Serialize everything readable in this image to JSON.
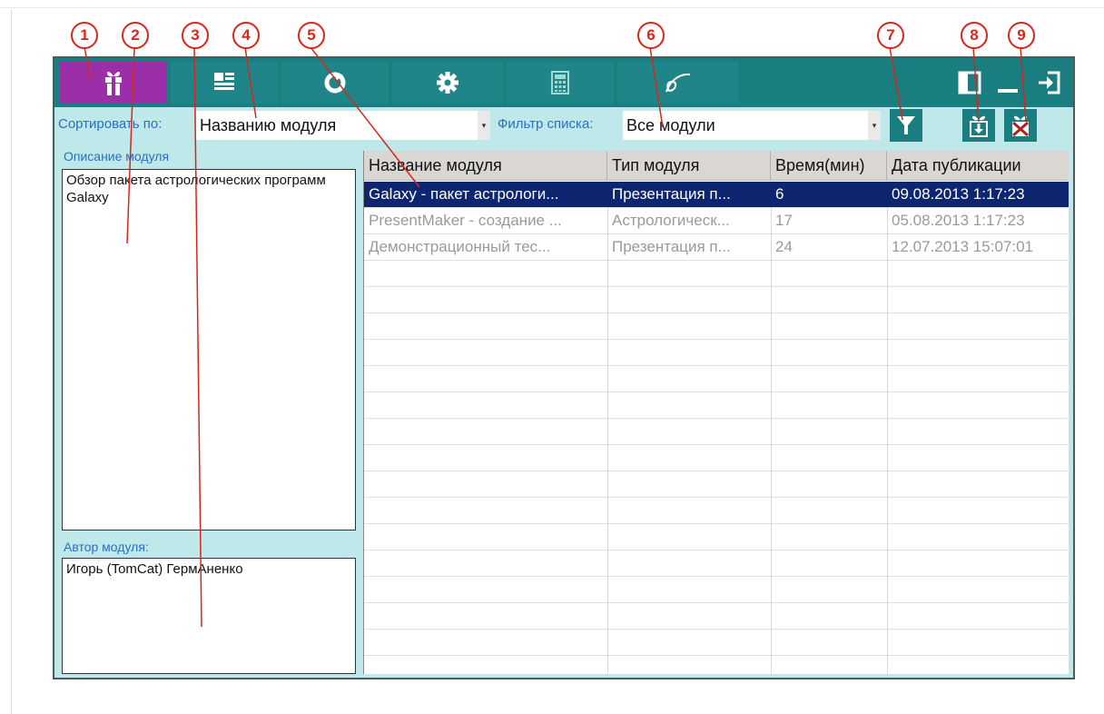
{
  "callouts": [
    "1",
    "2",
    "3",
    "4",
    "5",
    "6",
    "7",
    "8",
    "9"
  ],
  "toolbar": {
    "tabs": [
      {
        "icon": "gift-icon",
        "active": true
      },
      {
        "icon": "news-icon"
      },
      {
        "icon": "refresh-icon"
      },
      {
        "icon": "gear-icon"
      },
      {
        "icon": "calculator-icon"
      },
      {
        "icon": "galaxy-logo-icon"
      }
    ],
    "window_buttons": [
      "panel-toggle-icon",
      "minimize-icon",
      "exit-icon"
    ],
    "colors": {
      "bar": "#1a7d80",
      "active_tab": "#9a2fa8"
    }
  },
  "sort": {
    "label": "Сортировать по:",
    "value": "Названию модуля"
  },
  "filter": {
    "label": "Фильтр списка:",
    "value": "Все модули"
  },
  "actions": [
    "filter-icon",
    "install-module-icon",
    "delete-module-icon"
  ],
  "description": {
    "label": "Описание модуля",
    "text": "Обзор пакета астрологических программ Galaxy"
  },
  "author": {
    "label": "Автор модуля:",
    "text": "Игорь (TomCat) ГермАненко"
  },
  "table": {
    "columns": [
      "Название модуля",
      "Тип модуля",
      "Время(мин)",
      "Дата публикации"
    ],
    "rows": [
      {
        "name": "Galaxy - пакет астрологи...",
        "type": "Презентация п...",
        "time": "6",
        "date": "09.08.2013 1:17:23",
        "selected": true
      },
      {
        "name": "PresentMaker - создание ...",
        "type": "Астрологическ...",
        "time": "17",
        "date": "05.08.2013 1:17:23"
      },
      {
        "name": "Демонстрационный тес...",
        "type": "Презентация п...",
        "time": "24",
        "date": "12.07.2013 15:07:01"
      }
    ]
  }
}
